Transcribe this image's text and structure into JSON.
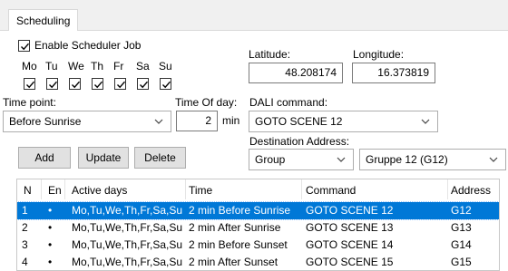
{
  "tab": {
    "label": "Scheduling"
  },
  "scheduler": {
    "enable_label": "Enable Scheduler Job",
    "enabled": true,
    "days": [
      {
        "label": "Mo",
        "checked": true
      },
      {
        "label": "Tu",
        "checked": true
      },
      {
        "label": "We",
        "checked": true
      },
      {
        "label": "Th",
        "checked": true
      },
      {
        "label": "Fr",
        "checked": true
      },
      {
        "label": "Sa",
        "checked": true
      },
      {
        "label": "Su",
        "checked": true
      }
    ]
  },
  "latitude": {
    "label": "Latitude:",
    "value": "48.208174"
  },
  "longitude": {
    "label": "Longitude:",
    "value": "16.373819"
  },
  "time_point": {
    "label": "Time point:",
    "value": "Before Sunrise"
  },
  "time_of_day": {
    "label": "Time Of day:",
    "value": "2",
    "unit": "min"
  },
  "dali": {
    "label": "DALI command:",
    "value": "GOTO SCENE 12"
  },
  "destination": {
    "label": "Destination Address:",
    "type_value": "Group",
    "group_value": "Gruppe 12 (G12)"
  },
  "buttons": {
    "add": "Add",
    "update": "Update",
    "delete": "Delete"
  },
  "table": {
    "columns": [
      "N",
      "En",
      "Active days",
      "Time",
      "Command",
      "Address"
    ],
    "rows": [
      {
        "n": "1",
        "en": "•",
        "days": "Mo,Tu,We,Th,Fr,Sa,Su",
        "time": "2 min Before Sunrise",
        "command": "GOTO SCENE 12",
        "address": "G12",
        "selected": true
      },
      {
        "n": "2",
        "en": "•",
        "days": "Mo,Tu,We,Th,Fr,Sa,Su",
        "time": "2 min After Sunrise",
        "command": "GOTO SCENE 13",
        "address": "G13",
        "selected": false
      },
      {
        "n": "3",
        "en": "•",
        "days": "Mo,Tu,We,Th,Fr,Sa,Su",
        "time": "2 min Before Sunset",
        "command": "GOTO SCENE 14",
        "address": "G14",
        "selected": false
      },
      {
        "n": "4",
        "en": "•",
        "days": "Mo,Tu,We,Th,Fr,Sa,Su",
        "time": "2 min After Sunset",
        "command": "GOTO SCENE 15",
        "address": "G15",
        "selected": false
      }
    ]
  },
  "colors": {
    "selection": "#0078d7",
    "background": "#ffffff",
    "chrome": "#f0f0f0"
  }
}
